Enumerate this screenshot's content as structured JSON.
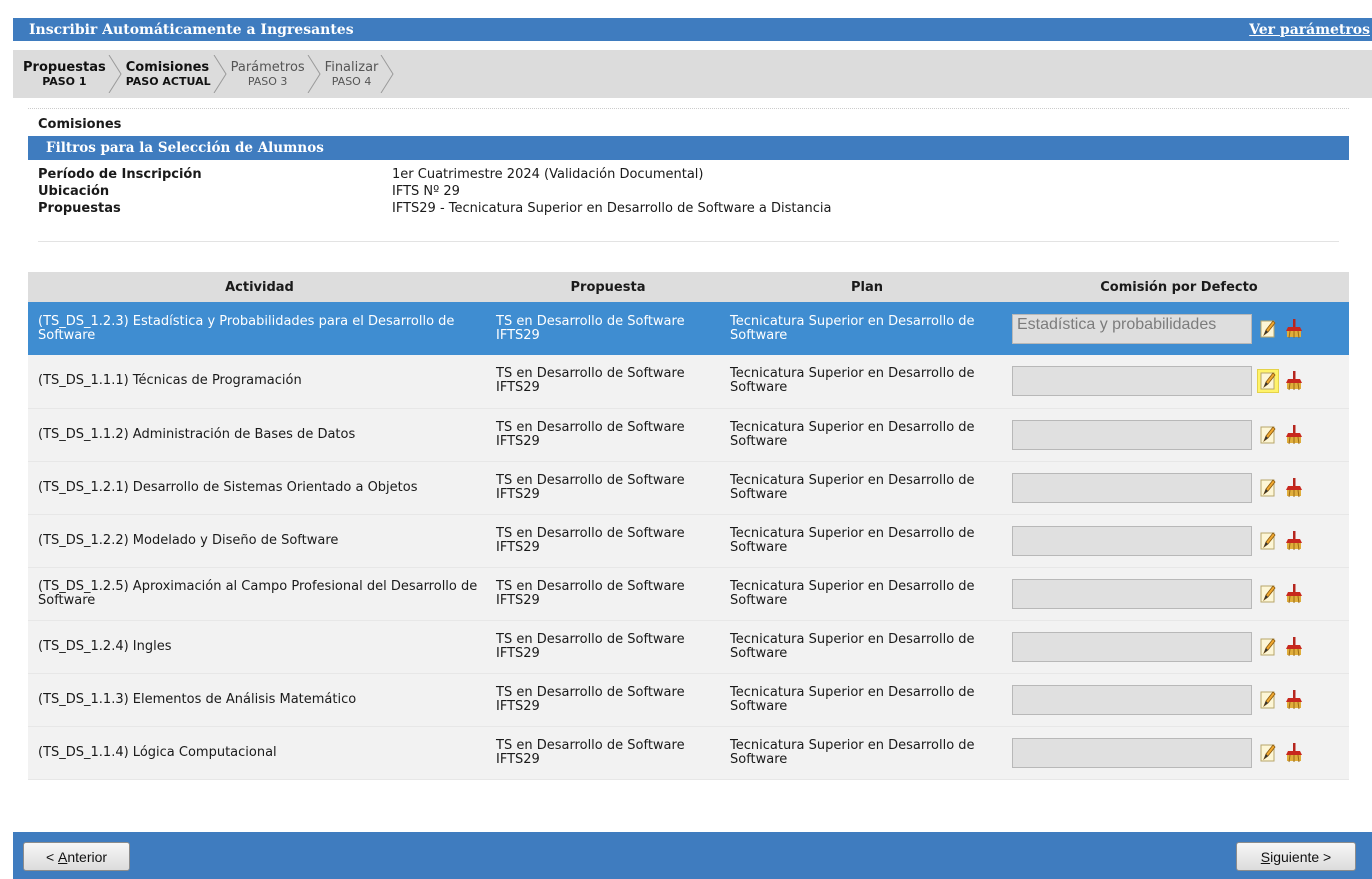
{
  "header": {
    "title": "Inscribir Automáticamente a Ingresantes",
    "link": "Ver parámetros"
  },
  "steps": [
    {
      "name": "Propuestas",
      "sub": "PASO 1",
      "state": "done"
    },
    {
      "name": "Comisiones",
      "sub": "PASO ACTUAL",
      "state": "current"
    },
    {
      "name": "Parámetros",
      "sub": "PASO 3",
      "state": "todo"
    },
    {
      "name": "Finalizar",
      "sub": "PASO 4",
      "state": "todo"
    }
  ],
  "section": {
    "title": "Comisiones"
  },
  "filters": {
    "title": "Filtros para la Selección de Alumnos",
    "rows": [
      {
        "label": "Período de Inscripción",
        "value": "1er Cuatrimestre 2024 (Validación Documental)"
      },
      {
        "label": "Ubicación",
        "value": "IFTS Nº 29"
      },
      {
        "label": "Propuestas",
        "value": "IFTS29 - Tecnicatura Superior en Desarrollo de Software a Distancia"
      }
    ]
  },
  "table": {
    "headers": [
      "Actividad",
      "Propuesta",
      "Plan",
      "Comisión por Defecto"
    ],
    "rows": [
      {
        "actividad": "(TS_DS_1.2.3) Estadística y Probabilidades para el Desarrollo de Software",
        "propuesta": "TS en Desarrollo de Software IFTS29",
        "plan": "Tecnicatura Superior en Desarrollo de Software",
        "comision": "Estadística y probabilidades",
        "selected": true
      },
      {
        "actividad": "(TS_DS_1.1.1) Técnicas de Programación",
        "propuesta": "TS en Desarrollo de Software IFTS29",
        "plan": "Tecnicatura Superior en Desarrollo de Software",
        "comision": "",
        "highlight_edit": true
      },
      {
        "actividad": "(TS_DS_1.1.2) Administración de Bases de Datos",
        "propuesta": "TS en Desarrollo de Software IFTS29",
        "plan": "Tecnicatura Superior en Desarrollo de Software",
        "comision": ""
      },
      {
        "actividad": "(TS_DS_1.2.1) Desarrollo de Sistemas Orientado a Objetos",
        "propuesta": "TS en Desarrollo de Software IFTS29",
        "plan": "Tecnicatura Superior en Desarrollo de Software",
        "comision": ""
      },
      {
        "actividad": "(TS_DS_1.2.2) Modelado y Diseño de Software",
        "propuesta": "TS en Desarrollo de Software IFTS29",
        "plan": "Tecnicatura Superior en Desarrollo de Software",
        "comision": ""
      },
      {
        "actividad": "(TS_DS_1.2.5) Aproximación al Campo Profesional del Desarrollo de Software",
        "propuesta": "TS en Desarrollo de Software IFTS29",
        "plan": "Tecnicatura Superior en Desarrollo de Software",
        "comision": ""
      },
      {
        "actividad": "(TS_DS_1.2.4) Ingles",
        "propuesta": "TS en Desarrollo de Software IFTS29",
        "plan": "Tecnicatura Superior en Desarrollo de Software",
        "comision": ""
      },
      {
        "actividad": "(TS_DS_1.1.3) Elementos de Análisis Matemático",
        "propuesta": "TS en Desarrollo de Software IFTS29",
        "plan": "Tecnicatura Superior en Desarrollo de Software",
        "comision": ""
      },
      {
        "actividad": "(TS_DS_1.1.4) Lógica Computacional",
        "propuesta": "TS en Desarrollo de Software IFTS29",
        "plan": "Tecnicatura Superior en Desarrollo de Software",
        "comision": ""
      }
    ]
  },
  "buttons": {
    "prev": {
      "prefix": "< ",
      "accel": "A",
      "rest": "nterior"
    },
    "next": {
      "accel": "S",
      "rest": "iguiente >"
    }
  },
  "colors": {
    "primary": "#3f7cbf",
    "selected_row": "#3f8dd1",
    "edit_highlight": "#fff36a"
  },
  "icons": {
    "edit": "pencil-edit-icon",
    "clear": "broom-clear-icon"
  }
}
